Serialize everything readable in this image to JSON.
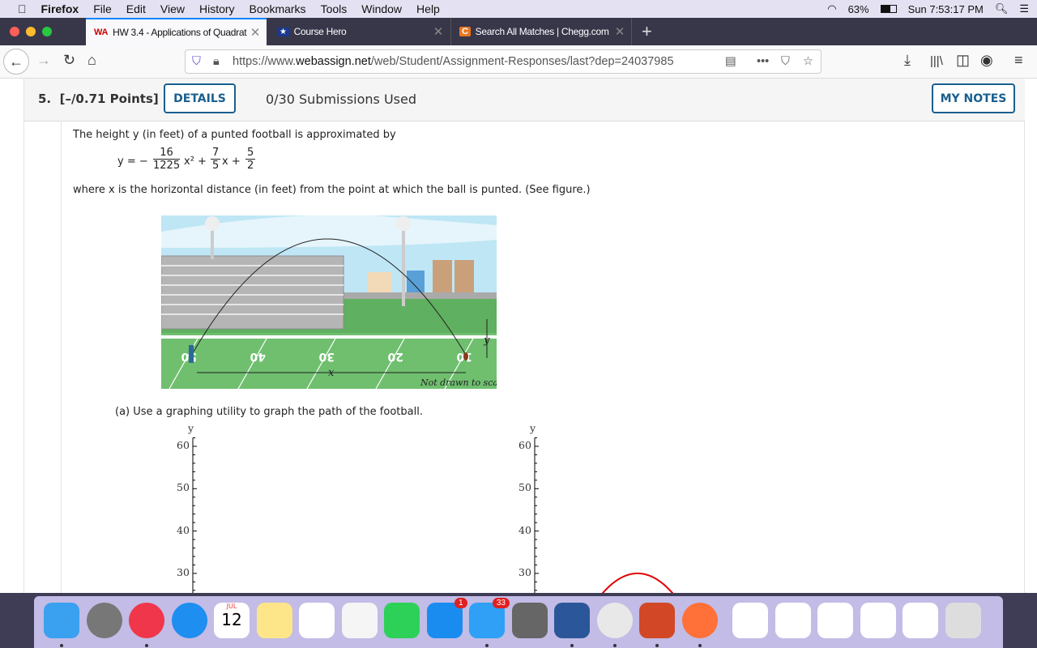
{
  "menubar": {
    "app": "Firefox",
    "items": [
      "File",
      "Edit",
      "View",
      "History",
      "Bookmarks",
      "Tools",
      "Window",
      "Help"
    ],
    "battery": "63%",
    "clock": "Sun 7:53:17 PM"
  },
  "tabs": [
    {
      "label": "HW 3.4 - Applications of Quadrat",
      "active": true
    },
    {
      "label": "Course Hero"
    },
    {
      "label": "Search All Matches | Chegg.com"
    }
  ],
  "nav": {
    "url_prefix": "https://www.",
    "url_domain": "webassign.net",
    "url_path": "/web/Student/Assignment-Responses/last?dep=24037985"
  },
  "question": {
    "number": "5.",
    "points": "[–/0.71 Points]",
    "details_label": "DETAILS",
    "submissions": "0/30 Submissions Used",
    "notes_label": "MY NOTES",
    "intro": "The height y (in feet) of a punted football is approximated by",
    "eq": {
      "lhs": "y = −",
      "a_num": "16",
      "a_den": "1225",
      "t1": "x² +",
      "b_num": "7",
      "b_den": "5",
      "t2": "x +",
      "c_num": "5",
      "c_den": "2"
    },
    "where": "where x is the horizontal distance (in feet) from the point at which the ball is punted. (See figure.)",
    "figure": {
      "x_label": "x",
      "y_label": "y",
      "note": "Not drawn to scale",
      "yard_numbers": [
        "50",
        "40",
        "30",
        "20",
        "10"
      ]
    },
    "part_a": "(a) Use a graphing utility to graph the path of the football."
  },
  "chart_data": [
    {
      "type": "line",
      "ylabel": "y",
      "ytick_labels": [
        "60",
        "50",
        "40",
        "30"
      ],
      "ylim_visible": [
        26,
        62
      ],
      "series": []
    },
    {
      "type": "line",
      "ylabel": "y",
      "ytick_labels": [
        "60",
        "50",
        "40",
        "30"
      ],
      "ylim_visible": [
        26,
        62
      ],
      "series": [
        {
          "color": "#e00000",
          "peak_y": 30
        }
      ]
    }
  ],
  "dock": {
    "badges": {
      "appstore": "1",
      "messages": "33"
    },
    "calendar": {
      "month": "JUL",
      "day": "12"
    }
  }
}
